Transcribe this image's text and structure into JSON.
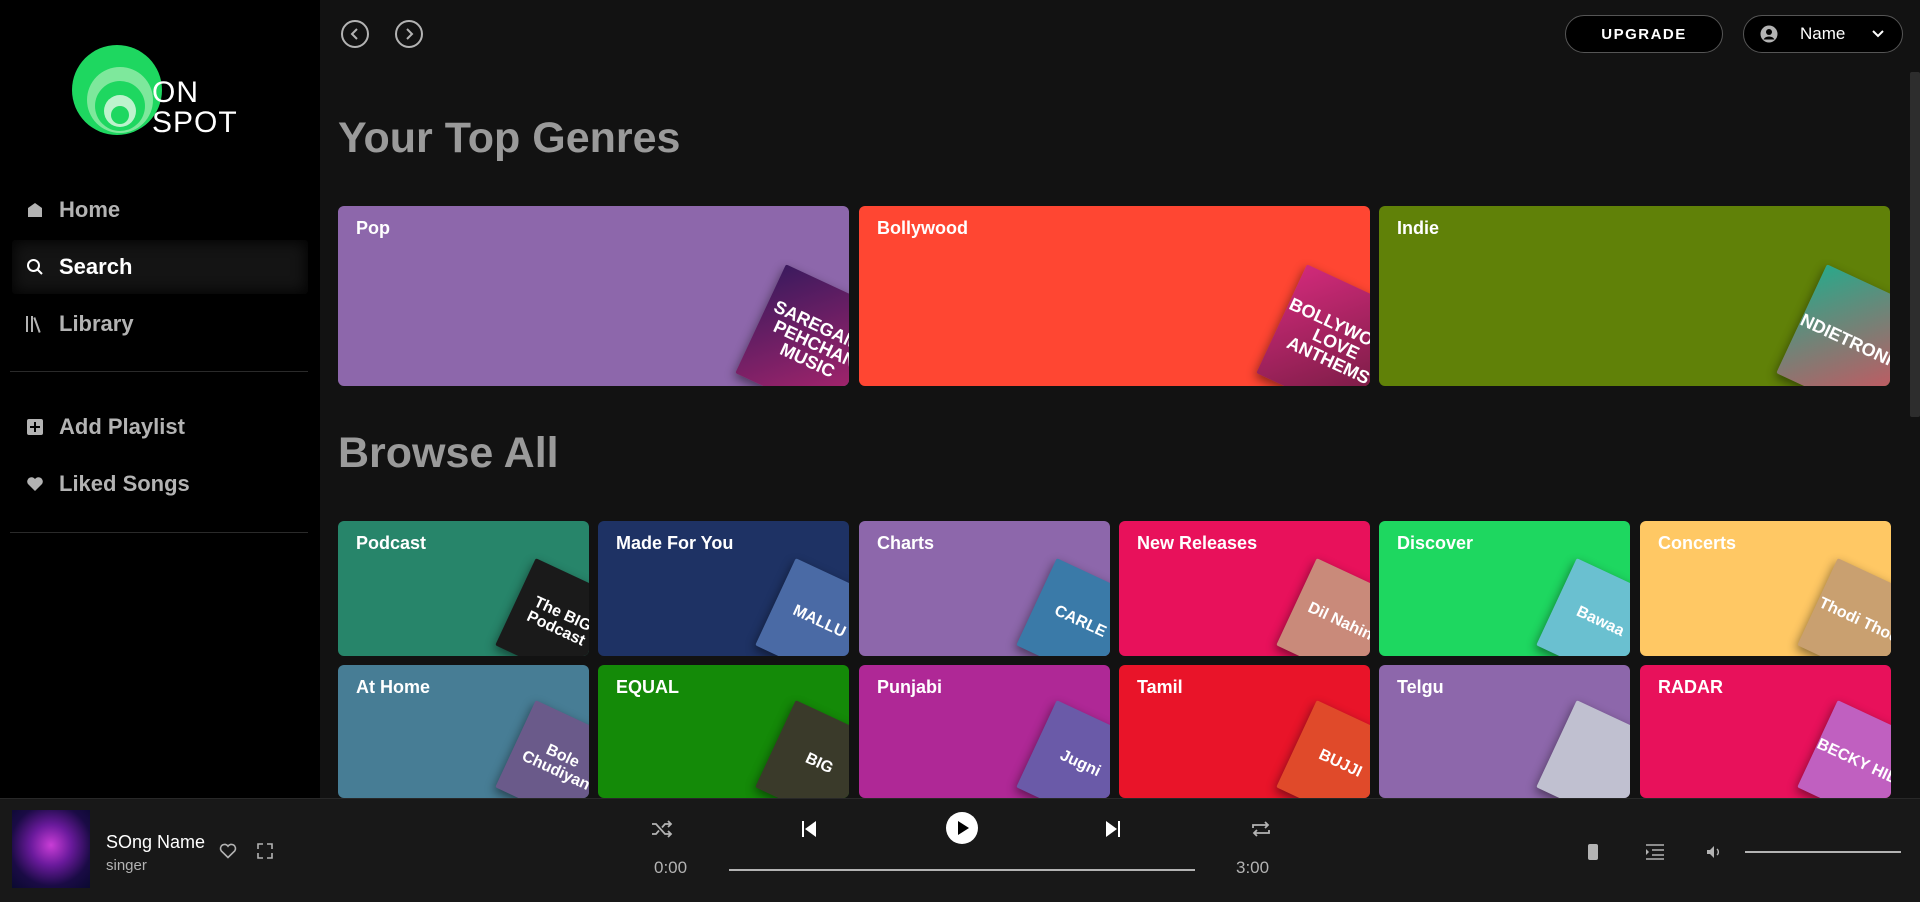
{
  "app": {
    "logo_line1": "ON",
    "logo_line2": "SPOT"
  },
  "sidebar": {
    "items": [
      {
        "label": "Home",
        "icon": "home-icon"
      },
      {
        "label": "Search",
        "icon": "search-icon",
        "active": true
      },
      {
        "label": "Library",
        "icon": "library-icon"
      }
    ],
    "secondary": [
      {
        "label": "Add Playlist",
        "icon": "plus-square-icon"
      },
      {
        "label": "Liked Songs",
        "icon": "heart-icon"
      }
    ]
  },
  "header": {
    "upgrade_label": "UPGRADE",
    "user_label": "Name"
  },
  "top_genres": {
    "title": "Your Top Genres",
    "cards": [
      {
        "label": "Pop",
        "color": "#8d67ab",
        "art": "SAREGAMA PEHCHAN MUSIC"
      },
      {
        "label": "Bollywood",
        "color": "#ff4632",
        "art": "BOLLYWOOD LOVE ANTHEMS"
      },
      {
        "label": "Indie",
        "color": "#608108",
        "art": "INDIETRONICA"
      }
    ]
  },
  "browse_all": {
    "title": "Browse All",
    "cards": [
      {
        "label": "Podcast",
        "color": "#27856a",
        "art": "The BIG Podcast"
      },
      {
        "label": "Made For You",
        "color": "#1e3264",
        "art": "MALLU"
      },
      {
        "label": "Charts",
        "color": "#8d67ab",
        "art": "CARLE"
      },
      {
        "label": "New Releases",
        "color": "#e8115b",
        "art": "Dil Nahin"
      },
      {
        "label": "Discover",
        "color": "#1ed760",
        "art": "Bawaa"
      },
      {
        "label": "Concerts",
        "color": "#ffc864",
        "art": "Thodi Thodi"
      },
      {
        "label": "At Home",
        "color": "#477d95",
        "art": "Bole Chudiyan"
      },
      {
        "label": "EQUAL",
        "color": "#148a08",
        "art": "BIG"
      },
      {
        "label": "Punjabi",
        "color": "#af2896",
        "art": "Jugni"
      },
      {
        "label": "Tamil",
        "color": "#e91429",
        "art": "BUJJI"
      },
      {
        "label": "Telgu",
        "color": "#8d67ab",
        "art": ""
      },
      {
        "label": "RADAR",
        "color": "#e8115b",
        "art": "BECKY HILL"
      }
    ]
  },
  "player": {
    "song_name": "SOng Name",
    "singer": "singer",
    "current_time": "0:00",
    "total_time": "3:00",
    "progress": 0,
    "volume": 1.0
  }
}
